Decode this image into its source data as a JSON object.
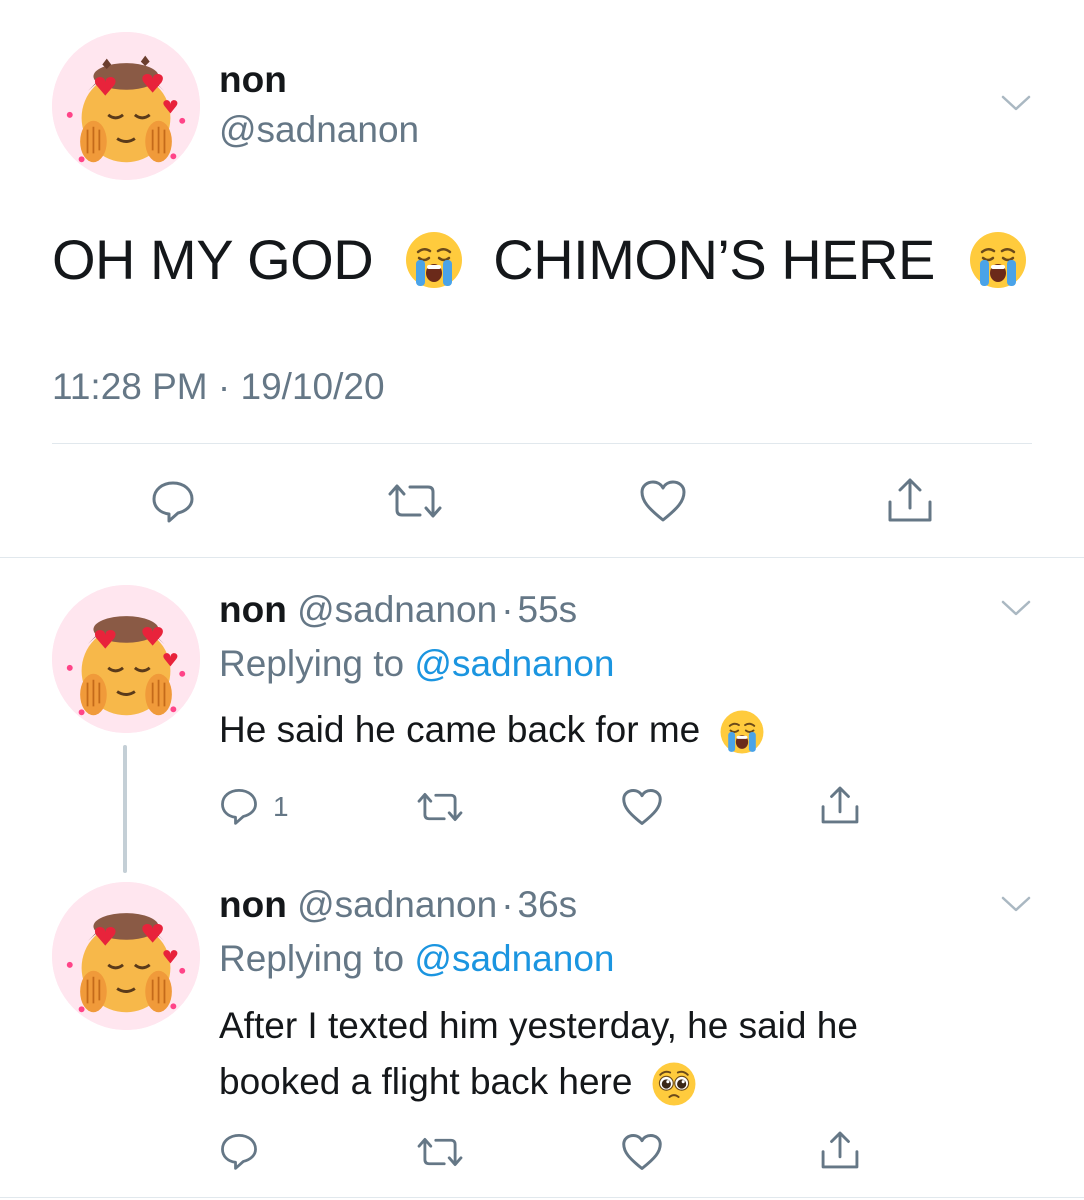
{
  "colors": {
    "text": "#14171a",
    "secondary": "#657786",
    "link": "#1b95e0",
    "divider": "#e1e8ed",
    "thread": "#c4cfd6"
  },
  "main_tweet": {
    "name": "non",
    "handle": "@sadnanon",
    "text_part1": "OH MY GOD",
    "text_part2": "CHIMON’S HERE",
    "emoji": "loudly-crying-face",
    "time": "11:28 PM",
    "separator": "·",
    "date": "19/10/20",
    "actions": [
      "reply-icon",
      "retweet-icon",
      "like-icon",
      "share-icon"
    ]
  },
  "replies": [
    {
      "name": "non",
      "handle": "@sadnanon",
      "dot": "·",
      "time": "55s",
      "replying_label": "Replying to",
      "replying_handle": "@sadnanon",
      "text": "He said he came back for me",
      "emoji": "loudly-crying-face",
      "reply_count": "1"
    },
    {
      "name": "non",
      "handle": "@sadnanon",
      "dot": "·",
      "time": "36s",
      "replying_label": "Replying to",
      "replying_handle": "@sadnanon",
      "text_line1": "After I texted him yesterday, he said he",
      "text_line2": "booked a flight back here",
      "emoji": "pleading-face",
      "reply_count": ""
    }
  ]
}
